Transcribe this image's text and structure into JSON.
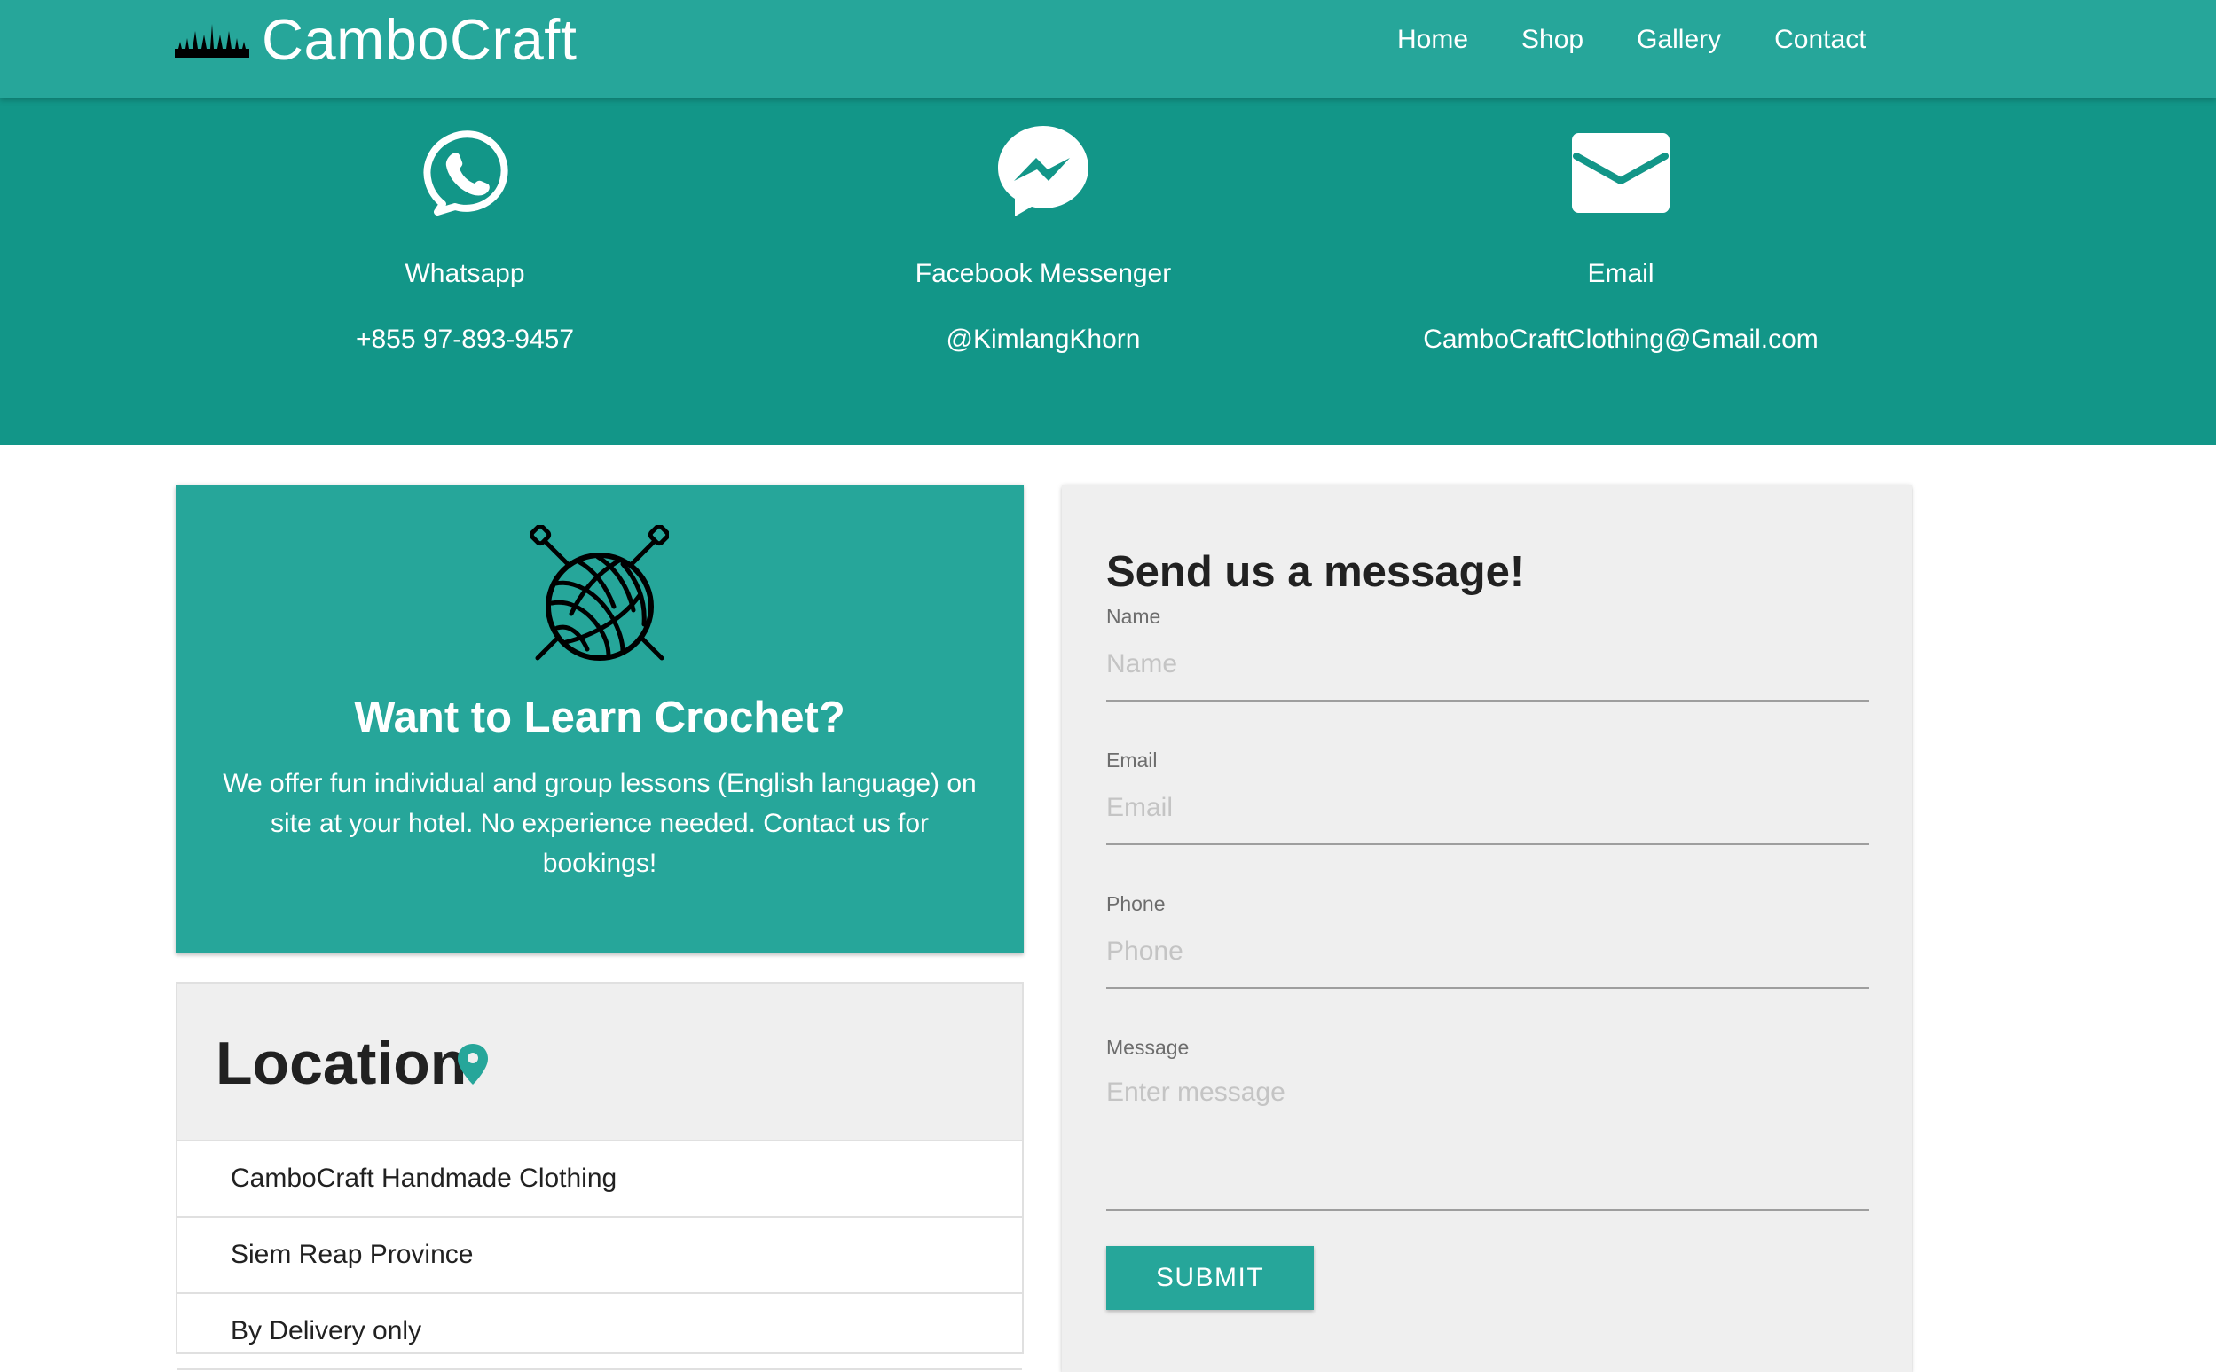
{
  "colors": {
    "navbar": "#26a69a",
    "hero": "#129688",
    "accent": "#26a69a",
    "panel": "#efefef",
    "text": "#212121"
  },
  "navbar": {
    "brand": "CamboCraft",
    "logo_icon": "temple-silhouette-icon",
    "links": [
      "Home",
      "Shop",
      "Gallery",
      "Contact"
    ]
  },
  "contacts": [
    {
      "icon": "whatsapp-icon",
      "title": "Whatsapp",
      "value": "+855 97-893-9457"
    },
    {
      "icon": "messenger-icon",
      "title": "Facebook Messenger",
      "value": "@KimlangKhorn"
    },
    {
      "icon": "envelope-icon",
      "title": "Email",
      "value": "CamboCraftClothing@Gmail.com"
    }
  ],
  "crochet": {
    "icon": "yarn-ball-icon",
    "title": "Want to Learn Crochet?",
    "text": "We offer fun individual and group lessons (English language) on site at your hotel. No experience needed. Contact us for bookings!"
  },
  "location": {
    "title": "Location",
    "icon": "map-pin-icon",
    "items": [
      "CamboCraft Handmade Clothing",
      "Siem Reap Province",
      "By Delivery only"
    ]
  },
  "form": {
    "title": "Send us a message!",
    "name_label": "Name",
    "name_placeholder": "Name",
    "email_label": "Email",
    "email_placeholder": "Email",
    "phone_label": "Phone",
    "phone_placeholder": "Phone",
    "message_label": "Message",
    "message_placeholder": "Enter message",
    "submit_label": "SUBMIT"
  }
}
